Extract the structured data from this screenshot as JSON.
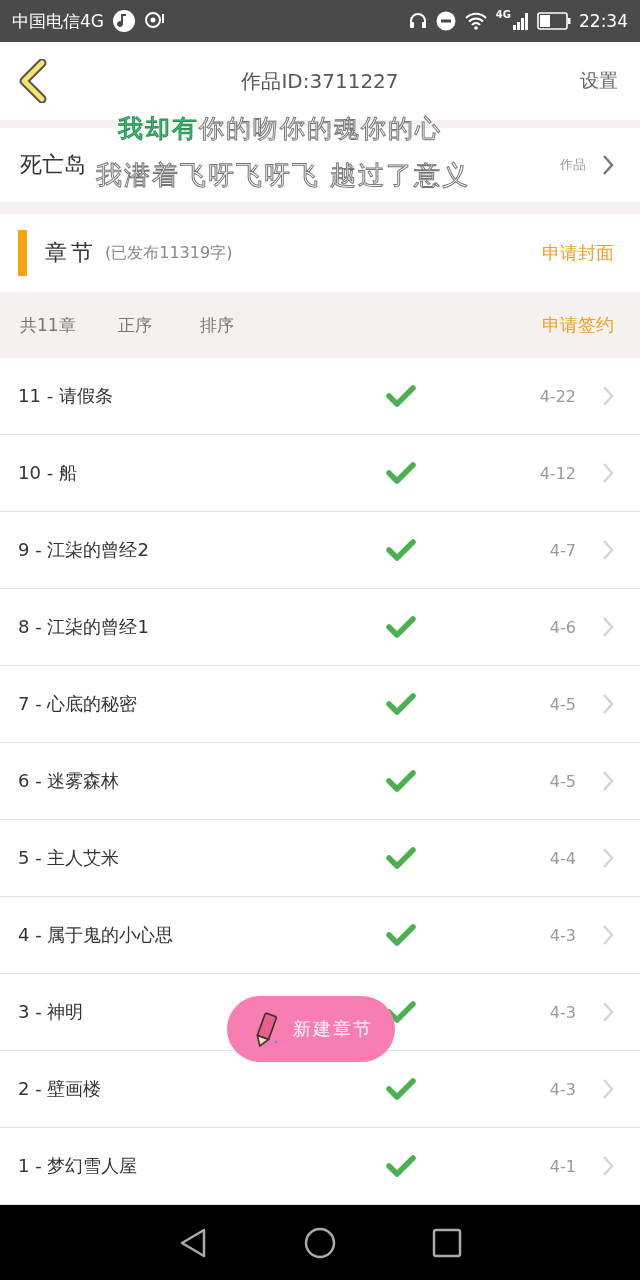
{
  "status_bar": {
    "carrier": "中国电信4G",
    "network": "4G",
    "time": "22:34"
  },
  "header": {
    "title": "作品ID:3711227",
    "settings": "设置"
  },
  "work": {
    "title": "死亡岛",
    "view_link": "作品"
  },
  "lyrics": {
    "line_1_sung": "我却有",
    "line_1_rest": "你的吻你的魂你的心",
    "line_2": "我潜着飞呀飞呀飞 越过了意义"
  },
  "section": {
    "title": "章节",
    "info": "(已发布11319字)",
    "apply_cover": "申请封面"
  },
  "toolbar": {
    "count": "共11章",
    "order_asc": "正序",
    "order_sort": "排序",
    "apply_contract": "申请签约"
  },
  "chapters": [
    {
      "title": "11 - 请假条",
      "published": true,
      "date": "4-22"
    },
    {
      "title": "10 - 船",
      "published": true,
      "date": "4-12"
    },
    {
      "title": "9 - 江柒的曾经2",
      "published": true,
      "date": "4-7"
    },
    {
      "title": "8 - 江柒的曾经1",
      "published": true,
      "date": "4-6"
    },
    {
      "title": "7 - 心底的秘密",
      "published": true,
      "date": "4-5"
    },
    {
      "title": "6 - 迷雾森林",
      "published": true,
      "date": "4-5"
    },
    {
      "title": "5 - 主人艾米",
      "published": true,
      "date": "4-4"
    },
    {
      "title": "4 - 属于鬼的小心思",
      "published": true,
      "date": "4-3"
    },
    {
      "title": "3 - 神明",
      "published": true,
      "date": "4-3"
    },
    {
      "title": "2 - 壁画楼",
      "published": true,
      "date": "4-3"
    },
    {
      "title": "1 - 梦幻雪人屋",
      "published": true,
      "date": "4-1"
    }
  ],
  "fab": {
    "label": "新建章节"
  }
}
